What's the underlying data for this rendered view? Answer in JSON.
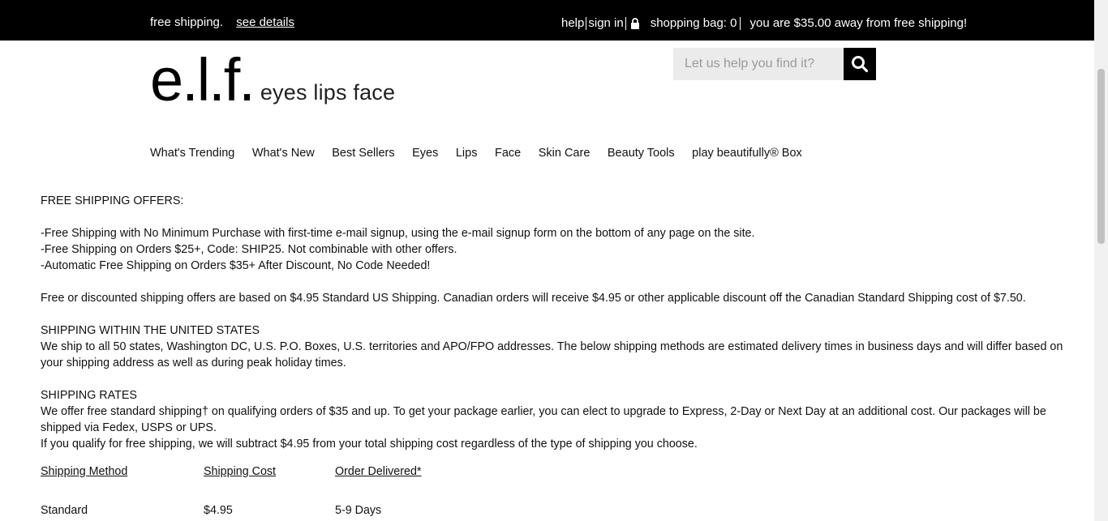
{
  "topbar": {
    "promo": "free shipping.",
    "see_details": "see details",
    "help": "help",
    "sign_in": "sign in",
    "shopping_bag": "shopping bag: 0",
    "away": "you are $35.00 away from free shipping!"
  },
  "logo": {
    "mark": "e.l.f.",
    "tagline": "eyes lips face"
  },
  "search": {
    "placeholder": "Let us help you find it?"
  },
  "nav": {
    "items": [
      "What's Trending",
      "What's New",
      "Best Sellers",
      "Eyes",
      "Lips",
      "Face",
      "Skin Care",
      "Beauty Tools",
      "play beautifully® Box"
    ]
  },
  "content": {
    "offers_heading": "FREE SHIPPING OFFERS:",
    "offer_1": "-Free Shipping with No Minimum Purchase with first-time e-mail signup, using the e-mail signup form on the bottom of any page on the site.",
    "offer_2": "-Free Shipping on Orders $25+, Code: SHIP25. Not combinable with other offers.",
    "offer_3": "-Automatic Free Shipping on Orders $35+ After Discount, No Code Needed!",
    "discount_note": "Free or discounted shipping offers are based on $4.95 Standard US Shipping. Canadian orders will receive $4.95 or other applicable discount off the Canadian Standard Shipping cost of $7.50.",
    "us_heading": "SHIPPING WITHIN THE UNITED STATES",
    "us_body": "We ship to all 50 states, Washington DC, U.S. P.O. Boxes, U.S. territories and APO/FPO addresses. The below shipping methods are estimated delivery times in business days and will differ based on your shipping address as well as during peak holiday times.",
    "rates_heading": "SHIPPING RATES",
    "rates_body": "We offer free standard shipping† on qualifying orders of $35 and up. To get your package earlier, you can elect to upgrade to Express, 2-Day or Next Day at an additional cost.  Our packages will be shipped via Fedex, USPS or UPS.",
    "rates_body_2": "If you qualify for free shipping, we will subtract $4.95 from your total shipping cost regardless of the type of shipping you choose."
  },
  "table": {
    "headers": [
      "Shipping Method",
      "Shipping Cost",
      "Order Delivered*"
    ],
    "rows": [
      [
        "Standard",
        "$4.95",
        "5-9 Days"
      ]
    ]
  }
}
